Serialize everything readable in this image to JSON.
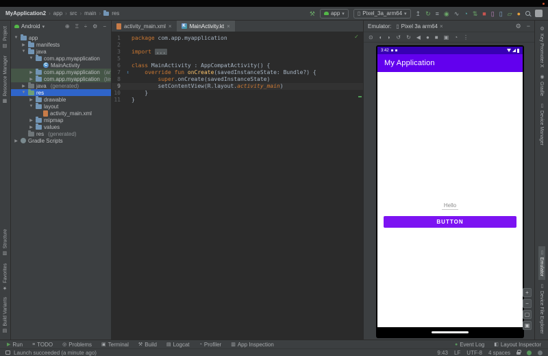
{
  "colors": {
    "accent_purple": "#6200EE",
    "status_purple": "#3700B3",
    "button_purple": "#7C13F2",
    "selection_blue": "#2F65CA",
    "run_green": "#599957",
    "stop_red": "#C75450"
  },
  "titlebar": {
    "breadcrumbs": [
      "MyApplication2",
      "app",
      "src",
      "main",
      "res"
    ],
    "separator": "›"
  },
  "toolbar": {
    "hammer": {
      "name": "build-hammer-icon",
      "glyph": "⚒",
      "color": "#6BA768"
    },
    "run_config": "app",
    "device": "Pixel_3a_arm64",
    "caret": "▾",
    "icons": [
      {
        "name": "apply-changes-icon",
        "glyph": "↥",
        "color": "#9FA7AC"
      },
      {
        "name": "gradle-sync-icon",
        "glyph": "↻",
        "color": "#6BA768"
      },
      {
        "name": "build-menu-icon",
        "glyph": "≡",
        "color": "#9FA7AC"
      },
      {
        "name": "debug-icon",
        "glyph": "◉",
        "color": "#6BA768"
      },
      {
        "name": "attach-debugger-icon",
        "glyph": "∿",
        "color": "#9FA7AC"
      },
      {
        "name": "profiler-icon",
        "glyph": "◔",
        "color": "#56A8A8"
      },
      {
        "name": "apply-code-changes-icon",
        "glyph": "⇅",
        "color": "#6BA768"
      },
      {
        "name": "stop-icon",
        "glyph": "■",
        "color": "#C75450"
      },
      {
        "name": "device-manager-icon",
        "glyph": "▯",
        "color": "#C286C2"
      },
      {
        "name": "avd-manager-icon",
        "glyph": "▯",
        "color": "#83A5C9"
      },
      {
        "name": "sdk-manager-icon",
        "glyph": "▱",
        "color": "#6BA768"
      },
      {
        "name": "notifications-icon",
        "glyph": "●",
        "color": "#E8A33D"
      }
    ]
  },
  "left_strip": {
    "top": [
      {
        "label": "Project",
        "icon": "▤",
        "name": "tool-project"
      },
      {
        "label": "Resource Manager",
        "icon": "▦",
        "name": "tool-resource-manager"
      }
    ],
    "bottom": [
      {
        "label": "Structure",
        "icon": "▥",
        "name": "tool-structure"
      },
      {
        "label": "Favorites",
        "icon": "★",
        "name": "tool-favorites"
      },
      {
        "label": "Build Variants",
        "icon": "▤",
        "name": "tool-build-variants"
      }
    ]
  },
  "right_strip": {
    "top": [
      {
        "label": "Key Promoter X",
        "icon": "⚙",
        "name": "tool-key-promoter-x"
      },
      {
        "label": "Gradle",
        "icon": "◉",
        "name": "tool-gradle"
      },
      {
        "label": "Device Manager",
        "icon": "▯",
        "name": "tool-device-manager"
      }
    ],
    "bottom": [
      {
        "label": "Emulator",
        "icon": "▯",
        "name": "tool-emulator",
        "active": true
      },
      {
        "label": "Device File Explorer",
        "icon": "▯",
        "name": "tool-device-file-explorer"
      }
    ]
  },
  "project": {
    "header": {
      "view": "Android",
      "caret": "▾",
      "actions": [
        {
          "name": "select-opened-file-icon",
          "glyph": "⊕"
        },
        {
          "name": "expand-collapse-icon",
          "glyph": "Ξ"
        },
        {
          "name": "collapse-all-icon",
          "glyph": "÷"
        },
        {
          "name": "settings-icon",
          "glyph": "⚙"
        },
        {
          "name": "hide-panel-icon",
          "glyph": "−"
        }
      ]
    },
    "items": [
      {
        "label": "app",
        "indent": 0,
        "arrow": "▼",
        "icon": "folder"
      },
      {
        "label": "manifests",
        "indent": 1,
        "arrow": "▶",
        "icon": "folder"
      },
      {
        "label": "java",
        "indent": 1,
        "arrow": "▼",
        "icon": "folder"
      },
      {
        "label": "com.app.myapplication",
        "indent": 2,
        "arrow": "▼",
        "icon": "package"
      },
      {
        "label": "MainActivity",
        "indent": 3,
        "arrow": "",
        "icon": "kclass"
      },
      {
        "label": "com.app.myapplication",
        "hint": "(androidTest)",
        "indent": 2,
        "arrow": "▶",
        "icon": "package",
        "test": true
      },
      {
        "label": "com.app.myapplication",
        "hint": "(test)",
        "indent": 2,
        "arrow": "▶",
        "icon": "package",
        "test": true
      },
      {
        "label": "java",
        "hint": "(generated)",
        "indent": 1,
        "arrow": "▶",
        "icon": "folder-gen"
      },
      {
        "label": "res",
        "indent": 1,
        "arrow": "▼",
        "icon": "folder-res",
        "selected": true
      },
      {
        "label": "drawable",
        "indent": 2,
        "arrow": "▶",
        "icon": "folder"
      },
      {
        "label": "layout",
        "indent": 2,
        "arrow": "▼",
        "icon": "folder"
      },
      {
        "label": "activity_main.xml",
        "indent": 3,
        "arrow": "",
        "icon": "xml"
      },
      {
        "label": "mipmap",
        "indent": 2,
        "arrow": "▶",
        "icon": "folder"
      },
      {
        "label": "values",
        "indent": 2,
        "arrow": "▶",
        "icon": "folder"
      },
      {
        "label": "res",
        "hint": "(generated)",
        "indent": 1,
        "arrow": "",
        "icon": "folder-gen"
      },
      {
        "label": "Gradle Scripts",
        "indent": 0,
        "arrow": "▶",
        "icon": "gradle"
      }
    ],
    "kotlin_class_letter": "C",
    "kotlin_file_letter": "K"
  },
  "editor": {
    "tabs": [
      {
        "label": "activity_main.xml",
        "icon": "xml",
        "close": "×",
        "active": false
      },
      {
        "label": "MainActivity.kt",
        "icon": "kt",
        "close": "×",
        "active": true
      }
    ],
    "inspection_ok": "✓",
    "lines": [
      {
        "n": "1",
        "seg": [
          {
            "t": "package ",
            "c": "kw"
          },
          {
            "t": "com.app.myapplication",
            "c": "pl"
          }
        ]
      },
      {
        "n": "2",
        "seg": []
      },
      {
        "n": "3",
        "seg": [
          {
            "t": "import ",
            "c": "kw"
          },
          {
            "t": "...",
            "c": "foldbox"
          }
        ]
      },
      {
        "n": "5",
        "seg": []
      },
      {
        "n": "6",
        "g": "activity",
        "seg": [
          {
            "t": "class ",
            "c": "kw"
          },
          {
            "t": "MainActivity : AppCompatActivity() {",
            "c": "pl"
          }
        ]
      },
      {
        "n": "7",
        "g": "override",
        "gglyph": "↥",
        "seg": [
          {
            "t": "    ",
            "c": "pl"
          },
          {
            "t": "override fun ",
            "c": "kw"
          },
          {
            "t": "onCreate",
            "c": "fn"
          },
          {
            "t": "(savedInstanceState: Bundle?) {",
            "c": "pl"
          }
        ]
      },
      {
        "n": "8",
        "seg": [
          {
            "t": "        ",
            "c": "pl"
          },
          {
            "t": "super",
            "c": "kw"
          },
          {
            "t": ".onCreate(savedInstanceState)",
            "c": "pl"
          }
        ]
      },
      {
        "n": "9",
        "current": true,
        "seg": [
          {
            "t": "        setContentView(R.layout.",
            "c": "pl"
          },
          {
            "t": "activity_main",
            "c": "res"
          },
          {
            "t": ")",
            "c": "pl"
          }
        ]
      },
      {
        "n": "10",
        "seg": [
          {
            "t": "    }",
            "c": "pl"
          }
        ]
      },
      {
        "n": "11",
        "seg": [
          {
            "t": "}",
            "c": "pl"
          }
        ]
      }
    ]
  },
  "emulator": {
    "panel_label": "Emulator:",
    "tab_label": "Pixel 3a arm64",
    "tab_close": "×",
    "tab_icon_glyph": "▯",
    "actions": [
      {
        "name": "emulator-settings-icon",
        "glyph": "⚙"
      },
      {
        "name": "hide-emulator-icon",
        "glyph": "−"
      }
    ],
    "toolbar": [
      {
        "name": "power-icon",
        "glyph": "⊙"
      },
      {
        "name": "volume-up-icon",
        "glyph": "◖"
      },
      {
        "name": "volume-down-icon",
        "glyph": "◗"
      },
      {
        "name": "rotate-left-icon",
        "glyph": "↺"
      },
      {
        "name": "rotate-right-icon",
        "glyph": "↻"
      },
      {
        "name": "back-icon",
        "glyph": "◀"
      },
      {
        "name": "home-icon",
        "glyph": "●"
      },
      {
        "name": "overview-icon",
        "glyph": "■"
      },
      {
        "name": "screenshot-icon",
        "glyph": "▣"
      },
      {
        "name": "snapshots-icon",
        "glyph": "◔"
      },
      {
        "name": "more-icon",
        "glyph": "⋮"
      }
    ],
    "zoom_controls": [
      {
        "name": "zoom-in-button",
        "glyph": "+"
      },
      {
        "name": "zoom-out-button",
        "glyph": "−"
      },
      {
        "name": "zoom-reset-button",
        "glyph": "▢"
      },
      {
        "name": "fit-screen-button",
        "glyph": "▣"
      }
    ],
    "phone": {
      "time": "3:42",
      "app_title": "My Application",
      "hello": "Hello",
      "button": "BUTTON"
    }
  },
  "toolwindow_bar": {
    "left": [
      {
        "label": "Run",
        "glyph": "▶",
        "color": "#599957",
        "name": "toolwin-run"
      },
      {
        "label": "TODO",
        "glyph": "≡",
        "name": "toolwin-todo"
      },
      {
        "label": "Problems",
        "glyph": "◎",
        "name": "toolwin-problems"
      },
      {
        "label": "Terminal",
        "glyph": "▣",
        "name": "toolwin-terminal"
      },
      {
        "label": "Build",
        "glyph": "⚒",
        "name": "toolwin-build"
      },
      {
        "label": "Logcat",
        "glyph": "▤",
        "name": "toolwin-logcat"
      },
      {
        "label": "Profiler",
        "glyph": "◔",
        "name": "toolwin-profiler"
      },
      {
        "label": "App Inspection",
        "glyph": "▥",
        "name": "toolwin-app-inspection"
      }
    ],
    "right": [
      {
        "label": "Event Log",
        "glyph": "●",
        "color": "#57965C",
        "name": "toolwin-event-log"
      },
      {
        "label": "Layout Inspector",
        "glyph": "◧",
        "name": "toolwin-layout-inspector"
      }
    ]
  },
  "statusbar": {
    "message": "Launch succeeded (a minute ago)",
    "position": "9:43",
    "line_ending": "LF",
    "encoding": "UTF-8",
    "indent": "4 spaces"
  }
}
